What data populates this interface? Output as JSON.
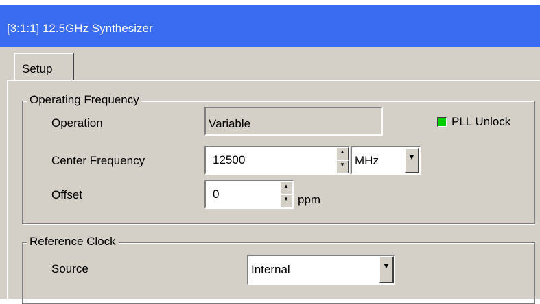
{
  "window": {
    "title": "[3:1:1] 12.5GHz Synthesizer"
  },
  "tabs": [
    {
      "label": "Setup"
    }
  ],
  "operating_frequency": {
    "legend": "Operating Frequency",
    "operation": {
      "label": "Operation",
      "value": "Variable"
    },
    "pll": {
      "label": "PLL Unlock",
      "color": "#00d000"
    },
    "center_frequency": {
      "label": "Center Frequency",
      "value": "12500",
      "unit": "MHz"
    },
    "offset": {
      "label": "Offset",
      "value": "0",
      "unit": "ppm"
    }
  },
  "reference_clock": {
    "legend": "Reference Clock",
    "source": {
      "label": "Source",
      "value": "Internal"
    }
  },
  "icons": {
    "spin_up": "▲",
    "spin_down": "▼",
    "combo_arrow": "▼"
  },
  "colors": {
    "titlebar": "#3a6cf2",
    "background": "#d4d0c8"
  }
}
